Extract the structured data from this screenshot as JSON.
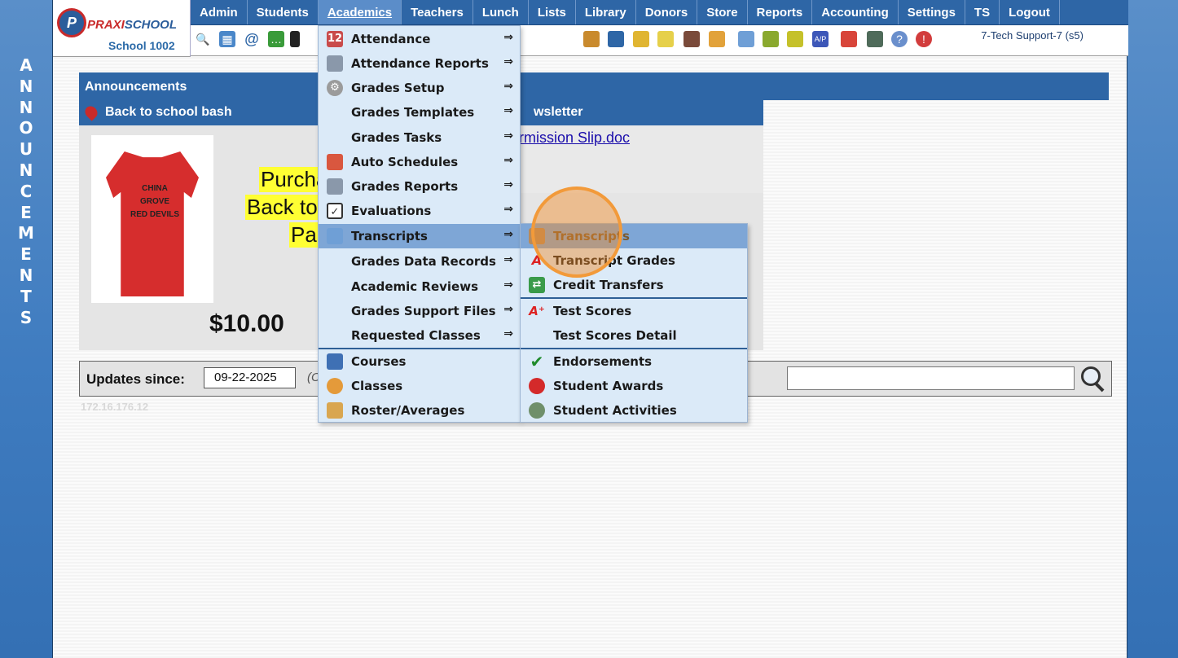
{
  "side_letters": [
    "A",
    "N",
    "N",
    "O",
    "U",
    "N",
    "C",
    "E",
    "M",
    "E",
    "N",
    "T",
    "S"
  ],
  "logo": {
    "letter": "P",
    "brand_prefix": "PRAXI",
    "brand_suffix": "SCHOOL",
    "school": "School 1002"
  },
  "menubar": {
    "items": [
      "Admin",
      "Students",
      "Academics",
      "Teachers",
      "Lunch",
      "Lists",
      "Library",
      "Donors",
      "Store",
      "Reports",
      "Accounting",
      "Settings",
      "TS",
      "Logout"
    ],
    "active": "Academics"
  },
  "user": "7-Tech Support-7 (s5)",
  "announcements": {
    "title": "Announcements",
    "item_title": "Back to school bash",
    "right_title": "wsletter",
    "link": "rmission Slip.doc",
    "shirt_print": [
      "CHINA GROVE",
      "RED DEVILS"
    ],
    "promo_lines": [
      "Purcha",
      "Back to",
      "Par"
    ],
    "price": "$10.00"
  },
  "updates": {
    "label": "Updates since:",
    "date": "09-22-2025",
    "note_fragment": "(C",
    "search_value": ""
  },
  "ip_text": "172.16.176.12",
  "academics_menu": [
    {
      "label": "Attendance",
      "icon": "calendar-icon",
      "arrow": "⇒"
    },
    {
      "label": "Attendance Reports",
      "icon": "printer-icon",
      "arrow": "⇒"
    },
    {
      "label": "Grades Setup",
      "icon": "gear-icon",
      "arrow": "⇒"
    },
    {
      "label": "Grades Templates",
      "icon": "",
      "arrow": "⇒"
    },
    {
      "label": "Grades Tasks",
      "icon": "",
      "arrow": "⇒"
    },
    {
      "label": "Auto Schedules",
      "icon": "schedule-icon",
      "arrow": "⇒"
    },
    {
      "label": "Grades Reports",
      "icon": "printer-icon",
      "arrow": "⇒"
    },
    {
      "label": "Evaluations",
      "icon": "checkbox-icon",
      "arrow": "⇒"
    },
    {
      "label": "Transcripts",
      "icon": "scroll-icon",
      "arrow": "⇒"
    },
    {
      "label": "Grades Data Records",
      "icon": "",
      "arrow": "⇒"
    },
    {
      "label": "Academic Reviews",
      "icon": "",
      "arrow": "⇒"
    },
    {
      "label": "Grades Support Files",
      "icon": "",
      "arrow": "⇒"
    },
    {
      "label": "Requested Classes",
      "icon": "",
      "arrow": "⇒"
    },
    {
      "label": "Courses",
      "icon": "book-icon",
      "arrow": ""
    },
    {
      "label": "Classes",
      "icon": "person-icon",
      "arrow": ""
    },
    {
      "label": "Roster/Averages",
      "icon": "roster-icon",
      "arrow": ""
    }
  ],
  "transcripts_menu": [
    {
      "label": "Transcripts",
      "icon": "scroll-icon"
    },
    {
      "label": "Transcript Grades",
      "icon": "grade-a-icon"
    },
    {
      "label": "Credit Transfers",
      "icon": "transfer-icon"
    },
    {
      "label": "Test Scores",
      "icon": "grade-a-plus-icon"
    },
    {
      "label": "Test Scores Detail",
      "icon": ""
    },
    {
      "label": "Endorsements",
      "icon": "checkmark-icon"
    },
    {
      "label": "Student Awards",
      "icon": "award-icon"
    },
    {
      "label": "Student Activities",
      "icon": "people-icon"
    }
  ]
}
